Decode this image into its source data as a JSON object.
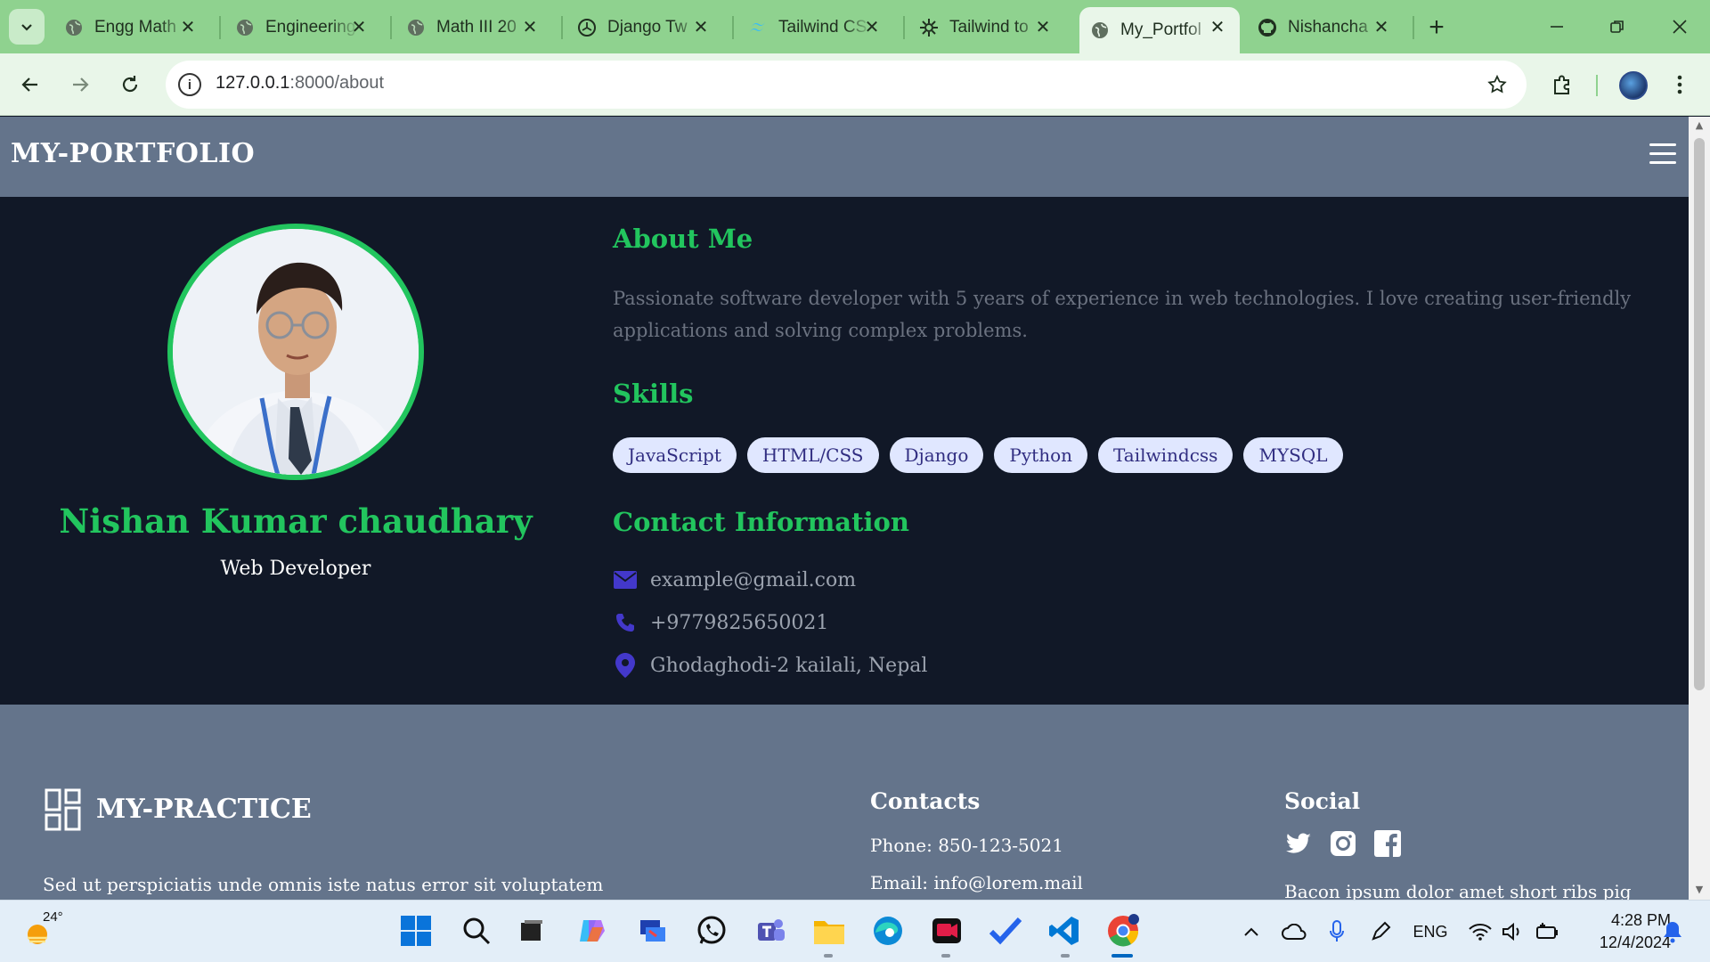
{
  "browser": {
    "tabs": [
      {
        "title": "Engg Math",
        "icon": "globe-icon"
      },
      {
        "title": "Engineering",
        "icon": "globe-icon"
      },
      {
        "title": "Math III 20",
        "icon": "globe-icon"
      },
      {
        "title": "Django Tw",
        "icon": "openai-icon"
      },
      {
        "title": "Tailwind CS",
        "icon": "tailwind-icon"
      },
      {
        "title": "Tailwind to",
        "icon": "gear-icon"
      },
      {
        "title": "My_Portfol",
        "icon": "globe-icon",
        "active": true
      },
      {
        "title": "Nishancha",
        "icon": "github-icon"
      }
    ],
    "url_host": "127.0.0.1",
    "url_path": ":8000/about"
  },
  "site": {
    "logo": "MY-PORTFOLIO",
    "name": "Nishan Kumar chaudhary",
    "role": "Web Developer",
    "about_heading": "About Me",
    "bio": "Passionate software developer with 5 years of experience in web technologies. I love creating user-friendly applications and solving complex problems.",
    "skills_heading": "Skills",
    "skills": [
      "JavaScript",
      "HTML/CSS",
      "Django",
      "Python",
      "Tailwindcss",
      "MYSQL"
    ],
    "contact_heading": "Contact Information",
    "email": "example@gmail.com",
    "phone": "+9779825650021",
    "location": "Ghodaghodi-2 kailali, Nepal"
  },
  "footer": {
    "logo": "MY-PRACTICE",
    "description": "Sed ut perspiciatis unde omnis iste natus error sit voluptatem",
    "contacts_heading": "Contacts",
    "phone": "Phone: 850-123-5021",
    "email": "Email: info@lorem.mail",
    "social_heading": "Social",
    "social_text": "Bacon ipsum dolor amet short ribs pig"
  },
  "taskbar": {
    "temperature": "24°",
    "language": "ENG",
    "time": "4:28 PM",
    "date": "12/4/2024"
  },
  "colors": {
    "accent": "#22c55e",
    "header_bg": "#64748b",
    "page_bg": "#111827",
    "chip_bg": "#e0e7ff",
    "chip_text": "#312e81",
    "icon_color": "#4338ca"
  }
}
